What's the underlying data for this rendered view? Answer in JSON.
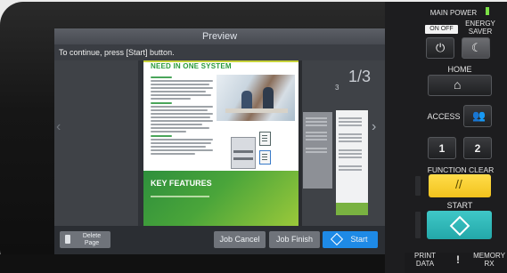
{
  "screen": {
    "title": "Preview",
    "message": "To continue, press [Start] button.",
    "page_indicator": "1/3",
    "next_page_number": "3",
    "document": {
      "heading": "NEED IN ONE SYSTEM",
      "features_title": "KEY FEATURES"
    },
    "buttons": {
      "delete_page": "Delete\nPage",
      "job_cancel": "Job Cancel",
      "job_finish": "Job Finish",
      "start": "Start"
    }
  },
  "panel": {
    "main_power": "MAIN POWER",
    "on_off": "ON OFF",
    "energy_saver": "ENERGY\nSAVER",
    "home": "HOME",
    "access": "ACCESS",
    "one": "1",
    "two": "2",
    "function_clear": "FUNCTION CLEAR",
    "start": "START",
    "print_data": "PRINT\nDATA",
    "memory_rx": "MEMORY\nRX",
    "exclamation": "!"
  },
  "colors": {
    "accent_blue": "#1e8ae6",
    "function_clear_yellow": "#f2c21d",
    "start_teal": "#23a8a9",
    "power_led": "#7be046"
  }
}
